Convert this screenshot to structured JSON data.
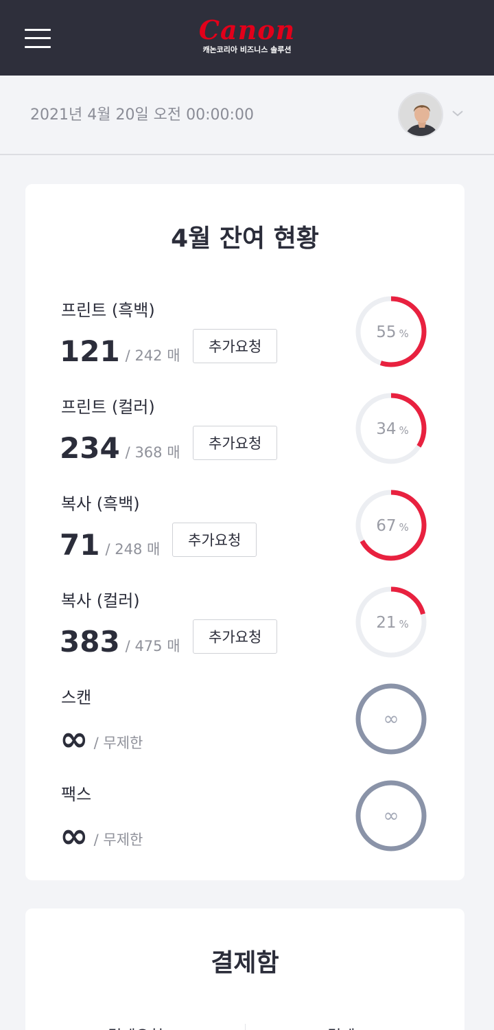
{
  "header": {
    "brand": "Canon",
    "subtitle": "캐논코리아 비즈니스 솔루션"
  },
  "datebar": {
    "datetime": "2021년 4월 20일 오전 00:00:00"
  },
  "summary": {
    "title": "4월 잔여 현황",
    "button_label": "추가요청",
    "unit": "매",
    "unlimited_label": "무제한",
    "infinity_symbol": "∞",
    "items": [
      {
        "label": "프린트 (흑백)",
        "value": "121",
        "total": "242",
        "percent": 55,
        "percent_text": "55"
      },
      {
        "label": "프린트 (컬러)",
        "value": "234",
        "total": "368",
        "percent": 34,
        "percent_text": "34"
      },
      {
        "label": "복사 (흑백)",
        "value": "71",
        "total": "248",
        "percent": 67,
        "percent_text": "67"
      },
      {
        "label": "복사 (컬러)",
        "value": "383",
        "total": "475",
        "percent": 21,
        "percent_text": "21"
      },
      {
        "label": "스캔",
        "unlimited": true
      },
      {
        "label": "팩스",
        "unlimited": true
      }
    ]
  },
  "payment": {
    "title": "결제함",
    "col_left": "결제요청",
    "col_right": "결제"
  },
  "colors": {
    "accent": "#e8213f",
    "track": "#eceef2",
    "unlimited_ring": "#8a93a8",
    "header_bg": "#2e2f3b"
  }
}
